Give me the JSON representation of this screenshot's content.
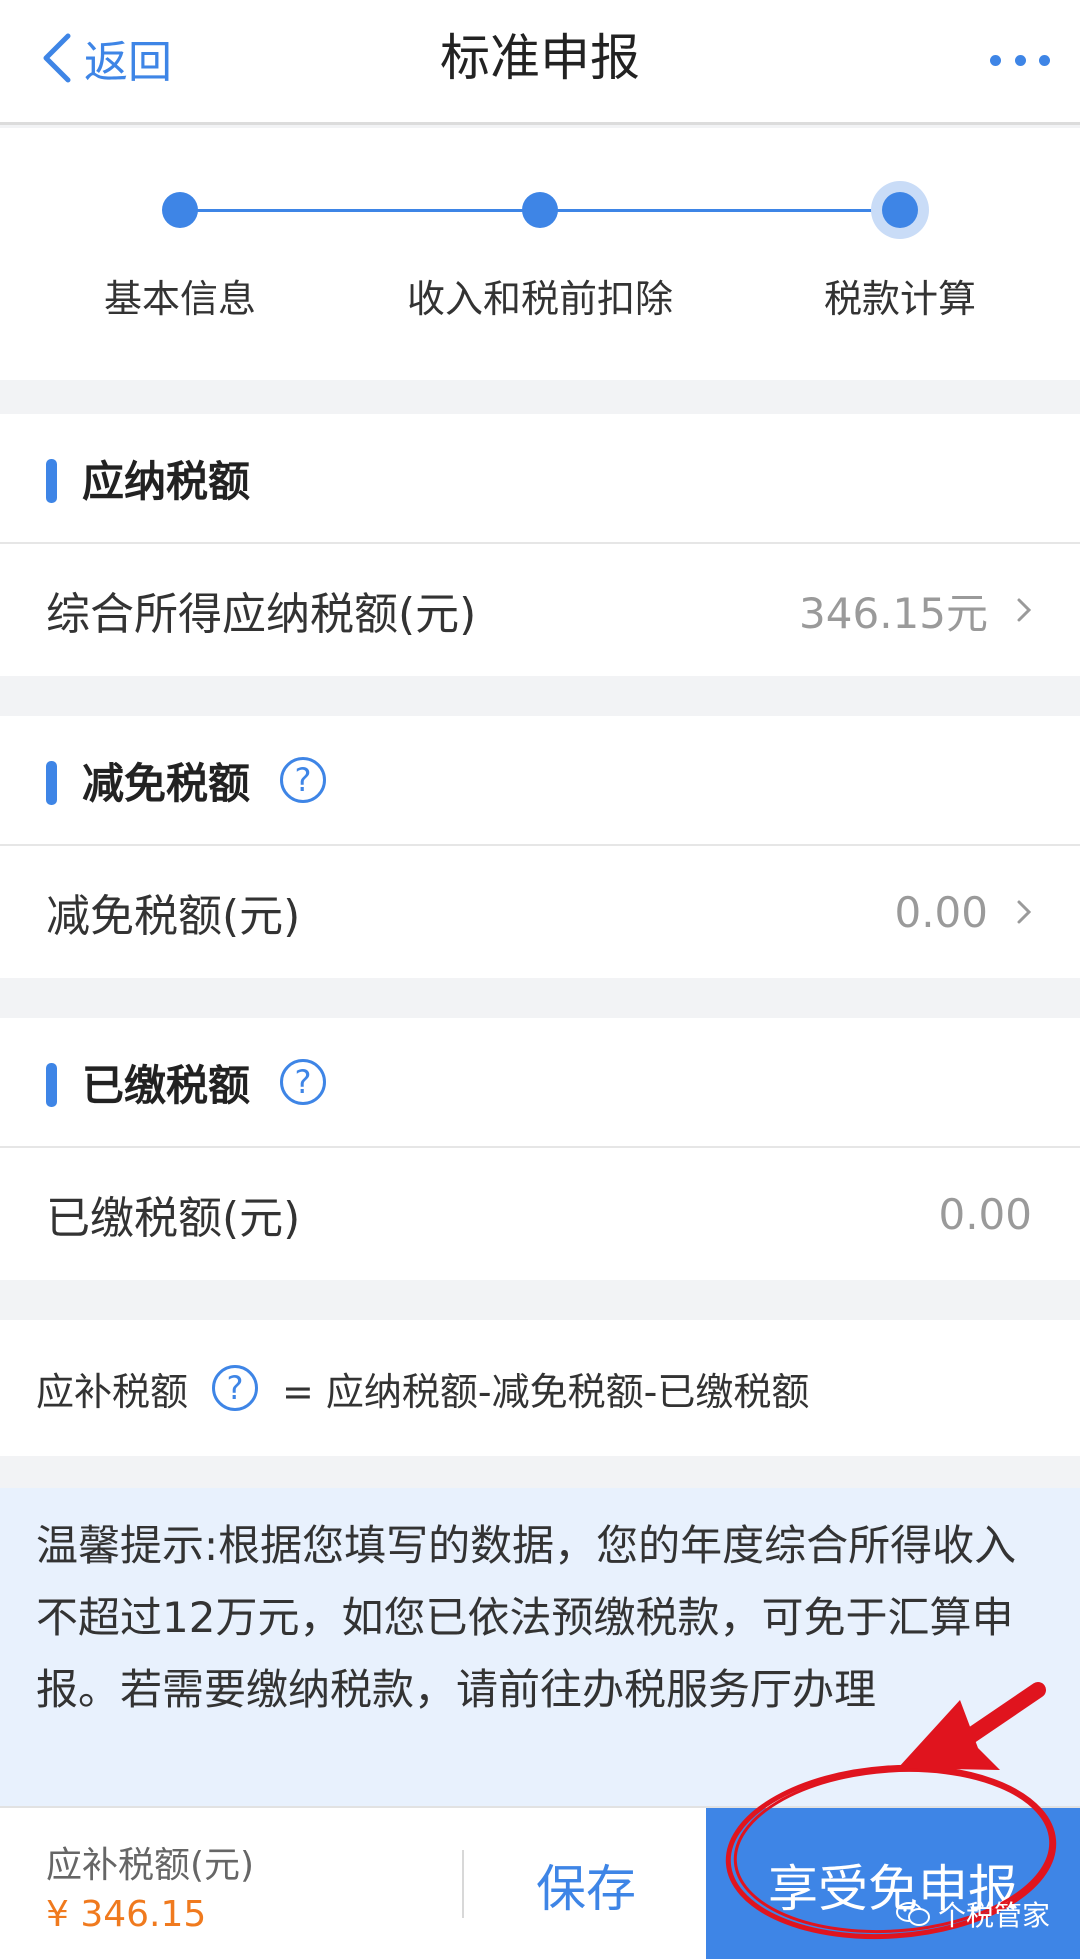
{
  "nav": {
    "back_label": "返回",
    "title": "标准申报"
  },
  "steps": [
    {
      "label": "基本信息"
    },
    {
      "label": "收入和税前扣除"
    },
    {
      "label": "税款计算"
    }
  ],
  "sections": {
    "payable": {
      "title": "应纳税额",
      "row_label": "综合所得应纳税额(元)",
      "row_value": "346.15元"
    },
    "relief": {
      "title": "减免税额",
      "row_label": "减免税额(元)",
      "row_value": "0.00"
    },
    "paid": {
      "title": "已缴税额",
      "row_label": "已缴税额(元)",
      "row_value": "0.00"
    }
  },
  "formula": {
    "label": "应补税额",
    "text": "= 应纳税额-减免税额-已缴税额"
  },
  "tip": {
    "text": "温馨提示:根据您填写的数据，您的年度综合所得收入不超过12万元，如您已依法预缴税款，可免于汇算申报。若需要缴纳税款，请前往办税服务厅办理"
  },
  "bottom": {
    "label": "应补税额(元)",
    "amount": "¥ 346.15",
    "save_label": "保存",
    "primary_label": "享受免申报"
  },
  "watermark": {
    "text": "个税管家"
  },
  "colors": {
    "accent": "#3e85e6",
    "amount": "#f07a1e",
    "annotation": "#e0141e"
  },
  "icons": [
    "back-chevron-icon",
    "more-icon",
    "help-icon",
    "chevron-right-icon",
    "arrow-annotation",
    "wechat-icon"
  ]
}
